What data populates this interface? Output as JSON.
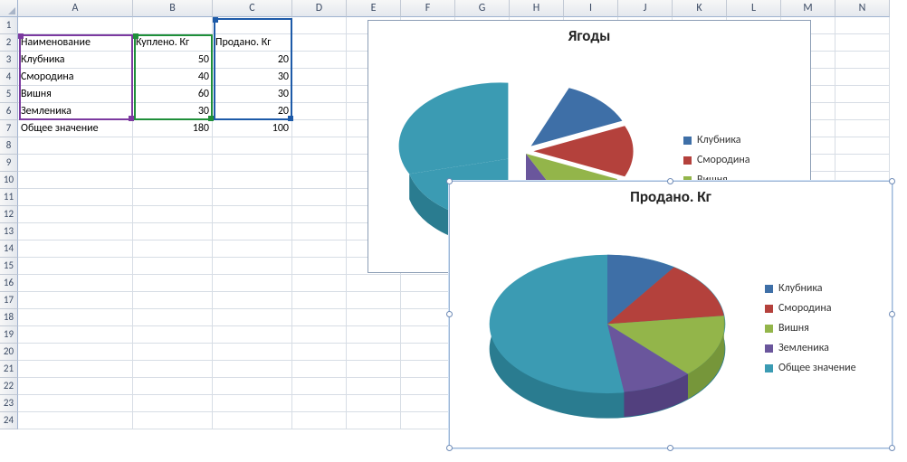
{
  "columns": [
    "A",
    "B",
    "C",
    "D",
    "E",
    "F",
    "G",
    "H",
    "I",
    "J",
    "K",
    "L",
    "M",
    "N"
  ],
  "rowCount": 24,
  "table": {
    "headers": {
      "name": "Наименование",
      "bought": "Куплено. Кг",
      "sold": "Продано. Кг"
    },
    "rows": [
      {
        "name": "Клубника",
        "bought": "50",
        "sold": "20"
      },
      {
        "name": "Смородина",
        "bought": "40",
        "sold": "30"
      },
      {
        "name": "Вишня",
        "bought": "60",
        "sold": "30"
      },
      {
        "name": "Земленика",
        "bought": "30",
        "sold": "20"
      },
      {
        "name": "Общее значение",
        "bought": "180",
        "sold": "100"
      }
    ]
  },
  "chart_data": [
    {
      "type": "pie",
      "title": "Ягоды",
      "series": [
        {
          "name": "Куплено. Кг",
          "values": [
            50,
            40,
            60,
            30,
            180
          ]
        }
      ],
      "categories": [
        "Клубника",
        "Смородина",
        "Вишня",
        "Земленика",
        "Общее значение"
      ],
      "colors": [
        "#3e6fa7",
        "#b4413c",
        "#93b54a",
        "#6a569c",
        "#3b9bb3"
      ],
      "legend_visible": [
        "Клубника",
        "Смородина",
        "Вишня"
      ],
      "legend_position": "right",
      "style": "3d-exploded"
    },
    {
      "type": "pie",
      "title": "Продано. Кг",
      "series": [
        {
          "name": "Продано. Кг",
          "values": [
            20,
            30,
            30,
            20,
            100
          ]
        }
      ],
      "categories": [
        "Клубника",
        "Смородина",
        "Вишня",
        "Земленика",
        "Общее значение"
      ],
      "colors": [
        "#3e6fa7",
        "#b4413c",
        "#93b54a",
        "#6a569c",
        "#3b9bb3"
      ],
      "legend_position": "right",
      "style": "3d"
    }
  ]
}
